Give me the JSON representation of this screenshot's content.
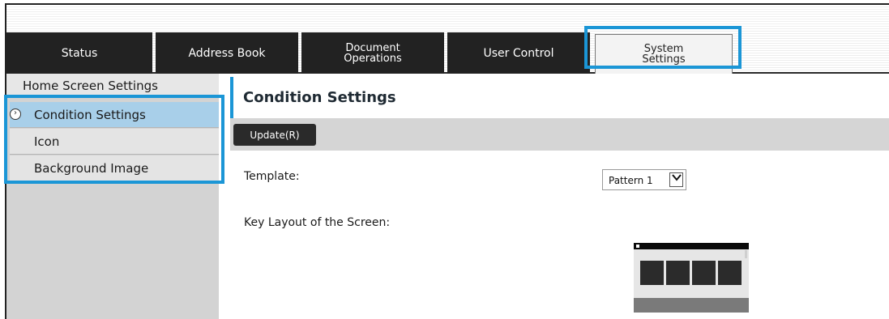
{
  "tabs": [
    {
      "label": "Status"
    },
    {
      "label": "Address Book"
    },
    {
      "label": "Document\nOperations"
    },
    {
      "label": "User Control"
    },
    {
      "label": "System\nSettings"
    }
  ],
  "sidebar": {
    "header": "Home Screen Settings",
    "items": [
      {
        "label": "Condition Settings"
      },
      {
        "label": "Icon"
      },
      {
        "label": "Background Image"
      }
    ]
  },
  "content": {
    "title": "Condition Settings",
    "update_button": "Update(R)",
    "template_label": "Template:",
    "template_value": "Pattern 1",
    "layout_label": "Key Layout of the Screen:"
  },
  "icons": {
    "selected": "chevron-circle-icon",
    "dropdown": "chevron-down-icon"
  },
  "colors": {
    "highlight": "#1b96d6",
    "tab": "#222222",
    "selected_item": "#a8cfe9"
  }
}
